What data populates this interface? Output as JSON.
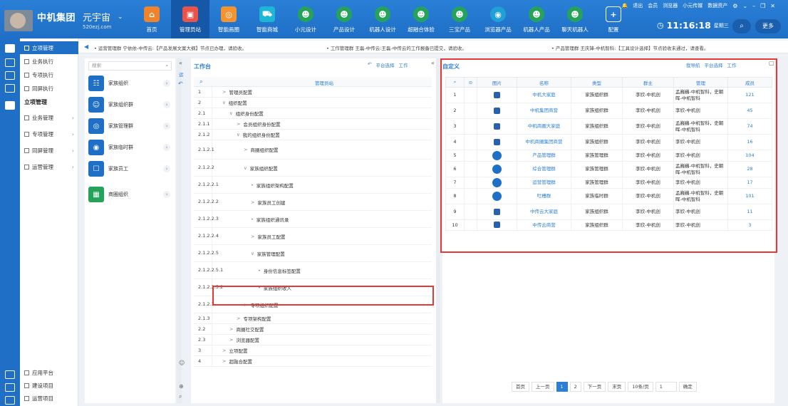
{
  "header": {
    "group_name": "中机集团",
    "brand": "元宇宙",
    "brand_url": "520ezj.com",
    "nav": [
      {
        "label": "首页",
        "color": "#f0842a",
        "icon": "home-icon"
      },
      {
        "label": "管理员站",
        "color": "#e9534a",
        "icon": "admin-icon"
      },
      {
        "label": "智能画圈",
        "color": "#f39431",
        "icon": "circle-icon"
      },
      {
        "label": "智能商城",
        "color": "#1db6d4",
        "icon": "cart-icon"
      },
      {
        "label": "小元设计",
        "color": "#26a35a",
        "icon": "robot-icon"
      },
      {
        "label": "产品设计",
        "color": "#26a35a",
        "icon": "robot-icon"
      },
      {
        "label": "机器人设计",
        "color": "#26a35a",
        "icon": "robot-icon"
      },
      {
        "label": "超融合体验",
        "color": "#26a35a",
        "icon": "robot-icon"
      },
      {
        "label": "三宝产品",
        "color": "#26a35a",
        "icon": "robot-icon"
      },
      {
        "label": "浏览器产品",
        "color": "#1fa0d6",
        "icon": "browser-icon"
      },
      {
        "label": "机器人产品",
        "color": "#26a35a",
        "icon": "robot-icon"
      },
      {
        "label": "聊天机器人",
        "color": "#26a35a",
        "icon": "robot-icon"
      },
      {
        "label": "配置",
        "color": "#2f7fd0",
        "icon": "plus-icon"
      }
    ],
    "top_links": [
      "退出",
      "会员",
      "浏览器",
      "小元传媒",
      "数据资产"
    ],
    "clock_time": "11:16:18",
    "clock_day": "星期三",
    "more": "更多"
  },
  "sidebar": {
    "items": [
      {
        "label": "立项管理",
        "active": true
      },
      {
        "label": "业务执行"
      },
      {
        "label": "专项执行"
      },
      {
        "label": "同屏执行"
      }
    ],
    "section": "立项管理",
    "sub": [
      {
        "label": "业务管理"
      },
      {
        "label": "专项管理"
      },
      {
        "label": "同屏管理"
      },
      {
        "label": "运营管理"
      }
    ],
    "bottom": [
      {
        "label": "应用平台"
      },
      {
        "label": "建设项目"
      },
      {
        "label": "运营项目"
      }
    ]
  },
  "notices": [
    "• 运营管理群 宁依依-中传云:【产品发展文案大纲】节点已办理，请验收。",
    "• 工作管理群 王磊-中传云:王磊-中传云的工作报备已提交，请验收。",
    "• 产品管理群 王庆锋-中机智科:【工具设计选择】节点验收未通过，请查看。"
  ],
  "panel1": {
    "search_placeholder": "搜索",
    "groups": [
      {
        "name": "家族组织",
        "color": "#1f6fc6"
      },
      {
        "name": "家族组织群",
        "color": "#1f6fc6"
      },
      {
        "name": "家族管理群",
        "color": "#1f6fc6"
      },
      {
        "name": "家族临时群",
        "color": "#1f6fc6"
      },
      {
        "name": "家族员工",
        "color": "#1f6fc6"
      },
      {
        "name": "商圈组织",
        "color": "#26a35a"
      }
    ]
  },
  "panel2": {
    "title": "工作台",
    "tool_platform": "平台选择",
    "tool_work": "工作",
    "col_header": "管理员站",
    "rows": [
      {
        "num": "1",
        "label": "管理员配置",
        "indent": 0,
        "icon": ">"
      },
      {
        "num": "2",
        "label": "组织配置",
        "indent": 0,
        "icon": "∨"
      },
      {
        "num": "2.1",
        "label": "组织身份配置",
        "indent": 1,
        "icon": "∨"
      },
      {
        "num": "2.1.1",
        "label": "会员组织身份配置",
        "indent": 2,
        "icon": ">"
      },
      {
        "num": "2.1.2",
        "label": "我的组织身份配置",
        "indent": 2,
        "icon": "∨"
      },
      {
        "num": "2.1.2.1",
        "label": "商圈组织配置",
        "indent": 3,
        "icon": ">"
      },
      {
        "num": "2.1.2.2",
        "label": "家族组织配置",
        "indent": 3,
        "icon": "∨"
      },
      {
        "num": "2.1.2.2.1",
        "label": "家族组织架构配置",
        "indent": 4,
        "icon": "•"
      },
      {
        "num": "2.1.2.2.2",
        "label": "家族员工创建",
        "indent": 4,
        "icon": ">"
      },
      {
        "num": "2.1.2.2.3",
        "label": "家族组织通讯录",
        "indent": 4,
        "icon": "•"
      },
      {
        "num": "2.1.2.2.4",
        "label": "家族员工配置",
        "indent": 4,
        "icon": ">"
      },
      {
        "num": "2.1.2.2.5",
        "label": "家族管理配置",
        "indent": 4,
        "icon": "∨"
      },
      {
        "num": "2.1.2.2.5.1",
        "label": "身份信息标签配置",
        "indent": 5,
        "icon": "•"
      },
      {
        "num": "2.1.2.2.5.2",
        "label": "家族组织收入",
        "indent": 5,
        "icon": "•"
      },
      {
        "num": "2.1.2.3",
        "label": "专项组织配置",
        "indent": 3,
        "icon": ">"
      },
      {
        "num": "2.1.3",
        "label": "专项架构配置",
        "indent": 2,
        "icon": ">"
      },
      {
        "num": "2.2",
        "label": "商圈社交配置",
        "indent": 1,
        "icon": ">"
      },
      {
        "num": "2.3",
        "label": "浏览器配置",
        "indent": 1,
        "icon": ">"
      },
      {
        "num": "3",
        "label": "立项配置",
        "indent": 0,
        "icon": ">"
      },
      {
        "num": "4",
        "label": "超融合配置",
        "indent": 0,
        "icon": ">"
      }
    ]
  },
  "panel3": {
    "title": "自定义",
    "tool_nav": "我导航",
    "tool_platform": "平台选择",
    "tool_work": "工作",
    "headers": [
      "图片",
      "名称",
      "类型",
      "群主",
      "管理",
      "成员"
    ],
    "rows": [
      {
        "n": "1",
        "name": "中机大家庭",
        "type": "家族组织群",
        "owner": "李欣-中机创",
        "admin": "孟巍巍-中机智科，史朝晖-中机智科",
        "members": "121",
        "pic": "sm"
      },
      {
        "n": "2",
        "name": "中机集团商营",
        "type": "家族组织群",
        "owner": "李欣-中机创",
        "admin": "李欣-中机创",
        "members": "45",
        "pic": "sm"
      },
      {
        "n": "3",
        "name": "中机商圈大家庭",
        "type": "家族组织群",
        "owner": "李欣-中机创",
        "admin": "孟巍巍-中机智科，史朝晖-中机智科",
        "members": "74",
        "pic": "sm"
      },
      {
        "n": "4",
        "name": "中机商圈集团商营",
        "type": "家族组织群",
        "owner": "李欣-中机创",
        "admin": "李欣-中机创",
        "members": "16",
        "pic": "sm"
      },
      {
        "n": "5",
        "name": "产品管理群",
        "type": "家族管理群",
        "owner": "李欣-中机创",
        "admin": "李欣-中机创",
        "members": "104",
        "pic": "c"
      },
      {
        "n": "6",
        "name": "综合管理群",
        "type": "家族管理群",
        "owner": "李欣-中机创",
        "admin": "孟巍巍-中机智科，史朝晖-中机智科",
        "members": "28",
        "pic": "c"
      },
      {
        "n": "7",
        "name": "运营管理群",
        "type": "家族管理群",
        "owner": "李欣-中机创",
        "admin": "李欣-中机创",
        "members": "17",
        "pic": "c"
      },
      {
        "n": "8",
        "name": "吐槽群",
        "type": "家族临时群",
        "owner": "李欣-中机创",
        "admin": "孟巍巍-中机智科，史朝晖-中机智科",
        "members": "101",
        "pic": "c"
      },
      {
        "n": "9",
        "name": "中传云大家庭",
        "type": "家族组织群",
        "owner": "李欣-中机创",
        "admin": "李欣-中机创",
        "members": "11",
        "pic": "sm"
      },
      {
        "n": "10",
        "name": "中传云商营",
        "type": "家族组织群",
        "owner": "李欣-中机创",
        "admin": "李欣-中机创",
        "members": "3",
        "pic": "sm"
      }
    ],
    "pager": {
      "first": "首页",
      "prev": "上一页",
      "p1": "1",
      "p2": "2",
      "next": "下一页",
      "last": "末页",
      "size": "10条/页",
      "page": "1",
      "go": "确定"
    }
  }
}
